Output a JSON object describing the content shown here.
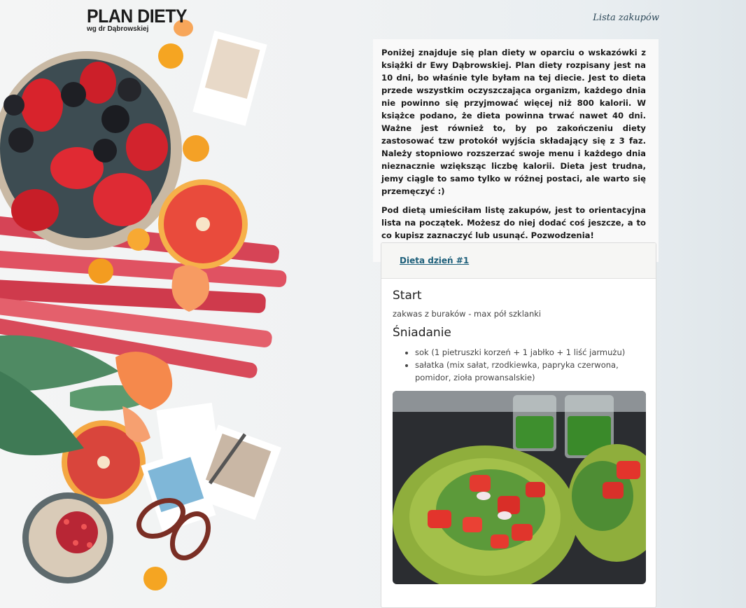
{
  "header": {
    "title": "PLAN DIETY",
    "subtitle": "wg dr Dąbrowskiej",
    "nav_link": "Lista zakupów"
  },
  "intro": {
    "paragraph1": "Poniżej znajduje się plan diety w oparciu o wskazówki z książki dr Ewy Dąbrowskiej. Plan diety rozpisany jest na 10 dni, bo właśnie tyle byłam na tej diecie. Jest to dieta przede wszystkim oczyszczająca organizm, każdego dnia nie powinno się przyjmować więcej niż 800 kalorii. W książce podano, że dieta powinna trwać nawet 40 dni. Ważne jest również to, by po zakończeniu diety zastosować tzw protokół wyjścia składający się z 3 faz. Należy stopniowo rozszerzać swoje menu i każdego dnia nieznacznie wziększąc liczbę kalorii. Dieta jest trudna, jemy ciągle to samo tylko w różnej postaci, ale warto się przemęczyć :)",
    "paragraph2": "Pod dietą umieściłam listę zakupów, jest to orientacyjna lista na początek. Możesz do niej dodać coś jeszcze, a to co kupisz zaznaczyć lub usunąć. Pozwodzenia!"
  },
  "day_card": {
    "tab_label": "Dieta dzień #1",
    "start_heading": "Start",
    "start_text": "zakwas z buraków - max pół szklanki",
    "breakfast_heading": "Śniadanie",
    "breakfast_items": [
      "sok (1 pietruszki korzeń + 1 jabłko + 1 liść jarmużu)",
      "sałatka (mix sałat, rzodkiewka, papryka czerwona, pomidor, zioła prowansalskie)"
    ]
  }
}
